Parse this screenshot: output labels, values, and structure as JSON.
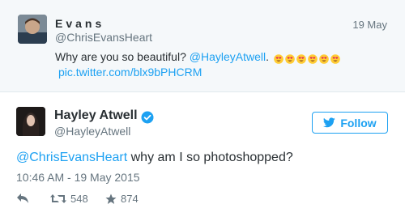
{
  "parent_tweet": {
    "name": "Evans",
    "handle": "@ChrisEvansHeart",
    "date": "19 May",
    "text": "Why are you so beautiful? ",
    "mention": "@HayleyAtwell",
    "punct": ".",
    "emoji_count": 6,
    "link": "pic.twitter.com/blx9bPHCRM"
  },
  "tweet": {
    "name": "Hayley Atwell",
    "handle": "@HayleyAtwell",
    "verified": true,
    "follow_label": "Follow",
    "mention": "@ChrisEvansHeart",
    "text": " why am I so photoshopped?",
    "timestamp": "10:46 AM - 19 May 2015"
  },
  "actions": {
    "reply_icon": "reply-icon",
    "retweet_count": "548",
    "like_count": "874"
  },
  "colors": {
    "accent": "#1da1f2",
    "muted": "#66757f",
    "text": "#292f33",
    "parent_bg": "#f5f8fa"
  }
}
